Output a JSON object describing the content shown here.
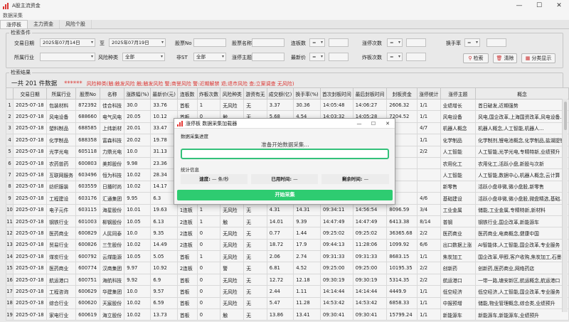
{
  "window": {
    "title": "A股主流资金",
    "min": "—",
    "max": "☐",
    "close": "✕"
  },
  "menu": {
    "label": "数据采集"
  },
  "tabs": [
    "涨停板",
    "主力资金",
    "风险个股"
  ],
  "search": {
    "legend": "检索条件",
    "trade_date_label": "交易日期",
    "date_from": "2025年07月14日",
    "to_label": "至",
    "date_to": "2025年07月19日",
    "code_label": "股票No",
    "code_value": "",
    "name_label": "股票名称",
    "lianban_label": "连板数",
    "lianban_op": "=",
    "zhangting_label": "涨停次数",
    "zhangting_op": "=",
    "huanshou_label": "换手率",
    "huanshou_op": "=",
    "industry_label": "所属行业",
    "industry_value": "",
    "risk_label": "风险种类",
    "risk_value": "全部",
    "st_label": "非ST",
    "st_value": "全部",
    "theme_label": "涨停主题",
    "price_label": "最新价",
    "price_op": "=",
    "zhaban_label": "炸板次数",
    "zhaban_op": "=",
    "search_btn": "检索",
    "clear_btn": "清除",
    "classify_btn": "分类显示"
  },
  "results": {
    "legend": "检索结果",
    "count_text": "一共 201 件数据",
    "stars": "******",
    "risk_legend": "风险种类(触:触发风险 触;触发风险 警;商誉风险 警:近期解禁 退;退市风险 查;立案调查 无风险)"
  },
  "table": {
    "headers": [
      "交易日期",
      "所属行业",
      "股票No",
      "名称",
      "涨跌幅(%)",
      "最新价(元)",
      "连板数",
      "炸板次数",
      "风险种类",
      "游资有无",
      "成交额(亿)",
      "换手率(%)",
      "首次封板时间",
      "最后封板时间",
      "封板资金",
      "涨停统计",
      "涨停主题",
      "概念"
    ],
    "rows": [
      [
        "2025-07-18",
        "包装材料",
        "872392",
        "佳合科技",
        "30.0",
        "33.76",
        "首板",
        "1",
        "无风险",
        "无",
        "3.37",
        "30.36",
        "14:05:48",
        "14:06:27",
        "2606.32",
        "1/1",
        "业绩增长",
        "首日破发,近期强势"
      ],
      [
        "2025-07-18",
        "风电设备",
        "688660",
        "电气风电",
        "20.05",
        "10.12",
        "首板",
        "0",
        "触",
        "无",
        "5.68",
        "4.54",
        "14:03:32",
        "14:05:28",
        "7204.52",
        "1/1",
        "风电设备",
        "风电,国企改革,上海国资改革,风电设备..."
      ],
      [
        "2025-07-18",
        "塑料制品",
        "688585",
        "上纬新材",
        "20.01",
        "33.47",
        "",
        "",
        "",
        "",
        "",
        "",
        "",
        "",
        "",
        "4/7",
        "机器人概念",
        "机器人概念,人工智能,机器人..."
      ],
      [
        "2025-07-18",
        "化学制品",
        "688358",
        "富森科技",
        "20.02",
        "19.78",
        "",
        "",
        "",
        "",
        "",
        "",
        "",
        "",
        "",
        "1/1",
        "化学制品",
        "化学制剂,锂电池概念,化学制品,盐湖提锂"
      ],
      [
        "2025-07-18",
        "光学光电",
        "605118",
        "力鼎光电",
        "10.0",
        "31.13",
        "",
        "",
        "",
        "",
        "",
        "",
        "",
        "",
        "",
        "2/2",
        "人工智能",
        "人工智能,光学光电,专精特新,业绩预升"
      ],
      [
        "2025-07-18",
        "农药兽药",
        "600803",
        "美邦股份",
        "9.98",
        "23.36",
        "",
        "",
        "",
        "",
        "",
        "",
        "",
        "",
        "",
        "",
        "农用化工",
        "农用化工,活跃小盘,新股与次新"
      ],
      [
        "2025-07-18",
        "互联网服务",
        "603496",
        "恒为科技",
        "10.02",
        "28.34",
        "",
        "",
        "",
        "",
        "",
        "",
        "",
        "",
        "",
        "",
        "人工智能",
        "人工智能,数据中心,机器人概念,云计算"
      ],
      [
        "2025-07-18",
        "纺织服装",
        "603559",
        "日播时尚",
        "10.02",
        "14.17",
        "",
        "",
        "",
        "",
        "",
        "",
        "",
        "",
        "",
        "",
        "新零售",
        "活跃小盘非微,微小盘股,新零售"
      ],
      [
        "2025-07-18",
        "工程建设",
        "603176",
        "汇通集团",
        "9.95",
        "6.3",
        "",
        "",
        "",
        "",
        "",
        "",
        "",
        "",
        "",
        "4/6",
        "基础建设",
        "活跃小盘非微,微小盘股,微盘精选,基础..."
      ],
      [
        "2025-07-18",
        "电子元件",
        "603115",
        "海星股份",
        "10.01",
        "19.63",
        "1连板",
        "1",
        "无风险",
        "无",
        "4.31",
        "14.31",
        "09:34:11",
        "14:56:54",
        "8096.59",
        "3/4",
        "工业金属",
        "储能,工业金属,专精特新,新材料"
      ],
      [
        "2025-07-18",
        "钢铁行业",
        "601003",
        "柳钢股份",
        "10.05",
        "6.13",
        "2连板",
        "1",
        "触",
        "无",
        "14.01",
        "9.39",
        "14:47:49",
        "14:47:49",
        "6413.38",
        "8/14",
        "普钢",
        "钢铁行业,国企改革,新能源车"
      ],
      [
        "2025-07-18",
        "医药商业",
        "600829",
        "人民同泰",
        "10.0",
        "9.35",
        "2连板",
        "0",
        "无风险",
        "无",
        "0.77",
        "1.44",
        "09:25:02",
        "09:25:02",
        "36365.68",
        "2/2",
        "医药商业",
        "医药商业,电商概念,健康中国"
      ],
      [
        "2025-07-18",
        "贸易行业",
        "600826",
        "三生股份",
        "10.02",
        "14.49",
        "2连板",
        "0",
        "无风险",
        "无",
        "18.72",
        "17.9",
        "09:44:13",
        "11:28:06",
        "1099.92",
        "6/6",
        "出口数据上涨",
        "AI智能体,人工智能,国企改革,专业服务"
      ],
      [
        "2025-07-18",
        "煤炭行业",
        "600792",
        "云煤能源",
        "10.05",
        "5.05",
        "首板",
        "1",
        "无风险",
        "无",
        "2.06",
        "2.74",
        "09:31:33",
        "09:31:33",
        "8683.15",
        "1/1",
        "焦炭加工",
        "国企改革,甲醇,客户收购,焦炭加工,石墨..."
      ],
      [
        "2025-07-18",
        "医药商业",
        "600774",
        "汉商集团",
        "9.97",
        "10.92",
        "2连板",
        "0",
        "警",
        "无",
        "6.81",
        "4.52",
        "09:25:00",
        "09:25:00",
        "10195.35",
        "2/2",
        "创新药",
        "创新药,医药商业,网络药店"
      ],
      [
        "2025-07-18",
        "航运港口",
        "600751",
        "海航科技",
        "9.92",
        "6.9",
        "首板",
        "0",
        "无风险",
        "无",
        "12.72",
        "12.18",
        "09:30:19",
        "09:30:19",
        "5314.35",
        "2/2",
        "航运港口",
        "一带一路,塘安新区,航运概念,航运港口"
      ],
      [
        "2025-07-18",
        "工程咨询",
        "600629",
        "华建集团",
        "10.0",
        "9.57",
        "首板",
        "0",
        "无风险",
        "无",
        "2.44",
        "1.11",
        "14:14:44",
        "14:14:44",
        "4449.9",
        "1/1",
        "低空经济",
        "低空经济,人工智能,国企改革,专业服务"
      ],
      [
        "2025-07-18",
        "综合行业",
        "600620",
        "天宸股份",
        "10.02",
        "6.59",
        "首板",
        "0",
        "无风险",
        "无",
        "5.47",
        "11.28",
        "14:53:42",
        "14:53:42",
        "6858.33",
        "1/1",
        "中报预增",
        "储能,物业管理概念,综合类,业绩预升"
      ],
      [
        "2025-07-18",
        "家电行业",
        "600619",
        "海立股份",
        "10.02",
        "13.73",
        "首板",
        "0",
        "触",
        "无",
        "13.86",
        "13.41",
        "09:30:41",
        "09:30:41",
        "15799.24",
        "1/1",
        "新能源车",
        "新能源车,新能源车,业绩预升"
      ]
    ]
  },
  "dialog": {
    "title": "涨停板 数据采集加载器",
    "progress_section": "数据采集进度",
    "status": "准备开始数据采集...",
    "progress": 0,
    "stats_section": "统计信息",
    "speed_label": "速度:",
    "speed_value": "— 条/秒",
    "elapsed_label": "已用时间:",
    "elapsed_value": "—",
    "remaining_label": "剩余时间:",
    "remaining_value": "—",
    "start_btn": "开始采集"
  }
}
